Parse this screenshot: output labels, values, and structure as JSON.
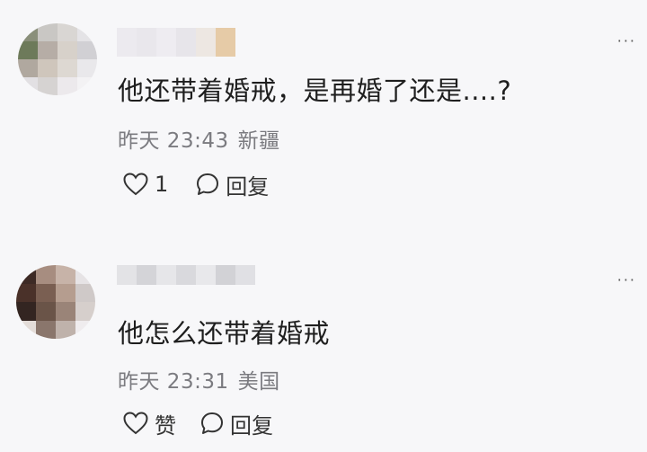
{
  "comments": [
    {
      "avatar_colors": [
        "#8a8f7a",
        "#c9c7c4",
        "#d9d6d3",
        "#e4e3e6",
        "#6d7a5a",
        "#b6ada6",
        "#d7d1ca",
        "#d1d0d4",
        "#b0a89f",
        "#cfc6bc",
        "#ddd8d2",
        "#e9e8eb",
        "#e2e0e3",
        "#d6d3d2",
        "#ece9ec",
        "#f3f2f4"
      ],
      "name_colors": [
        "#eceaef",
        "#e9e7ec",
        "#eeecf1",
        "#e7e5ea",
        "#ede7e2",
        "#e6cba7"
      ],
      "content": "他还带着婚戒，是再婚了还是....?",
      "time": "昨天 23:43",
      "location": "新疆",
      "like_label": "1",
      "reply_label": "回复",
      "more_label": "···"
    },
    {
      "avatar_colors": [
        "#3d2a25",
        "#a78d80",
        "#c7b3a8",
        "#e6e3e5",
        "#4a3129",
        "#7a5f52",
        "#b59d8f",
        "#cfc9c8",
        "#332521",
        "#6a5448",
        "#9a8478",
        "#d6cfcc",
        "#e3dcd8",
        "#8a766c",
        "#bfb2ab",
        "#efecee"
      ],
      "name_colors": [
        "#e3e3e6",
        "#d4d4d8",
        "#e6e6e9",
        "#d9d9dd",
        "#e8e8eb",
        "#d2d2d6",
        "#e0e0e4"
      ],
      "content": "他怎么还带着婚戒",
      "time": "昨天 23:31",
      "location": "美国",
      "like_label": "赞",
      "reply_label": "回复",
      "more_label": "···"
    }
  ]
}
